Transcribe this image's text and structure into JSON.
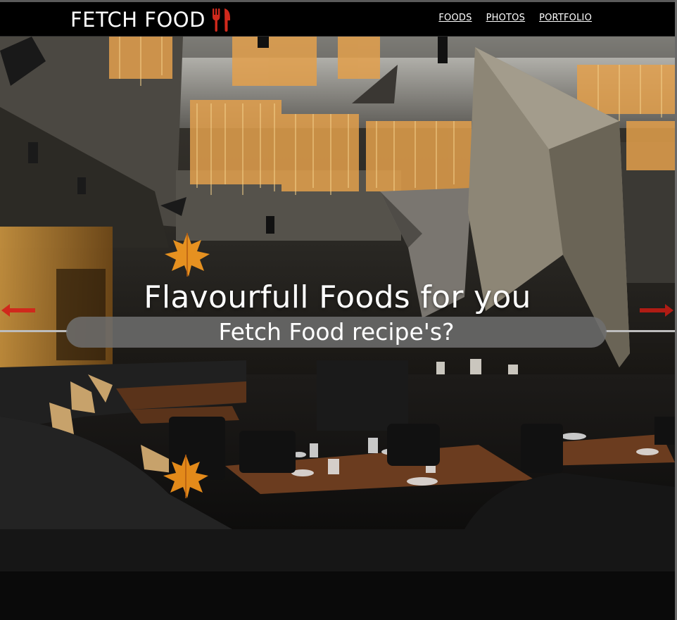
{
  "brand": {
    "name": "FETCH FOOD",
    "icon": "fork-knife-icon"
  },
  "nav": {
    "items": [
      {
        "label": "FOODS"
      },
      {
        "label": "PHOTOS"
      },
      {
        "label": "PORTFOLIO"
      }
    ]
  },
  "hero": {
    "headline": "Flavourfull Foods for you",
    "subheadline": "Fetch Food recipe's?",
    "prev_icon": "arrow-left-icon",
    "next_icon": "arrow-right-icon",
    "decorations": "maple-leaf-icon"
  },
  "colors": {
    "header_bg": "#000000",
    "accent": "#d0291c",
    "pill_bg": "#6e6e6e",
    "text": "#ffffff"
  }
}
